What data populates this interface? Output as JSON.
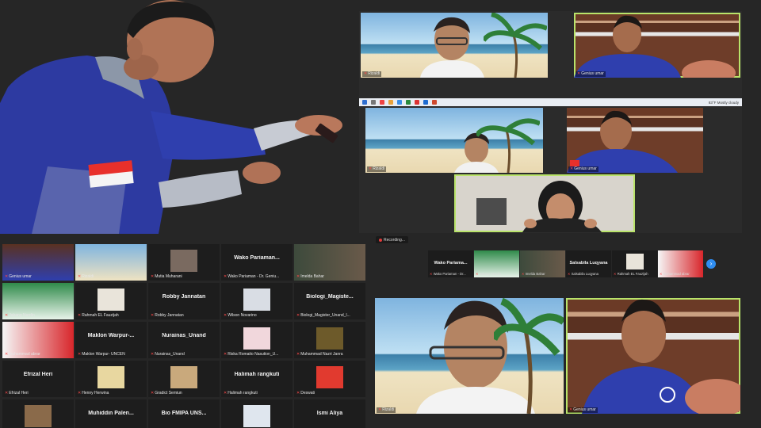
{
  "top_right": {
    "tiles": [
      {
        "name": "Rizaldi"
      },
      {
        "name": "Genius umar"
      },
      {
        "name": "Rizaldi"
      },
      {
        "name": "Genius umar"
      },
      {
        "name": ""
      }
    ],
    "taskbar_weather": "83°F  Mostly cloudy"
  },
  "grid": [
    {
      "name": "Genius umar",
      "label": ""
    },
    {
      "name": "Rizaldi",
      "label": ""
    },
    {
      "name": "Mutia Muharani",
      "label": ""
    },
    {
      "name": "Wako Pariaman - Dr. Geniu...",
      "label": "Wako Pariaman..."
    },
    {
      "name": "Imelda Bahar",
      "label": ""
    },
    {
      "name": "Jabang Nurdin",
      "label": ""
    },
    {
      "name": "Rahmah EL Fauzijah",
      "label": ""
    },
    {
      "name": "Robby Jannatan",
      "label": "Robby Jannatan"
    },
    {
      "name": "Wilson Novarino",
      "label": ""
    },
    {
      "name": "Biologi_Magister_Unand_l...",
      "label": "Biologi_Magiste..."
    },
    {
      "name": "muhammad abrar",
      "label": ""
    },
    {
      "name": "Maklon Warpur- UNCEN",
      "label": "Maklon Warpur-..."
    },
    {
      "name": "Nurainas_Unand",
      "label": "Nurainas_Unand"
    },
    {
      "name": "Riska Romaito Nasution_U...",
      "label": ""
    },
    {
      "name": "Muhammad Nazri Janra",
      "label": ""
    },
    {
      "name": "Efrizal Heri",
      "label": "Efrizal Heri"
    },
    {
      "name": "Henny Herwina",
      "label": ""
    },
    {
      "name": "Gradict Semiun",
      "label": ""
    },
    {
      "name": "Halimah rangkuti",
      "label": "Halimah rangkuti"
    },
    {
      "name": "Deswati",
      "label": ""
    },
    {
      "name": "",
      "label": ""
    },
    {
      "name": "",
      "label": "Muhiddin Palen..."
    },
    {
      "name": "",
      "label": "Bio FMIPA UNS..."
    },
    {
      "name": "",
      "label": ""
    },
    {
      "name": "",
      "label": "Ismi Aliya"
    }
  ],
  "bottom_right": {
    "recording_label": "Recording...",
    "strip": [
      {
        "name": "Wako Pariaman - Dr...",
        "label": "Wako Pariama..."
      },
      {
        "name": "Jabang Nurdin",
        "label": ""
      },
      {
        "name": "Imelda Bahar",
        "label": ""
      },
      {
        "name": "Salsabila Luqyana",
        "label": "Salsabila Luqyana"
      },
      {
        "name": "Rahmah EL Fauzijah",
        "label": ""
      },
      {
        "name": "muhammad abrar",
        "label": ""
      }
    ],
    "next_icon": "›",
    "speakers": [
      {
        "name": "Rizaldi"
      },
      {
        "name": "Genius umar"
      }
    ]
  },
  "colors": {
    "active_speaker": "#b9e36a",
    "muted_mic": "#ff4a4a",
    "recording_dot": "#e23b3b",
    "next_button": "#2f8df0"
  }
}
